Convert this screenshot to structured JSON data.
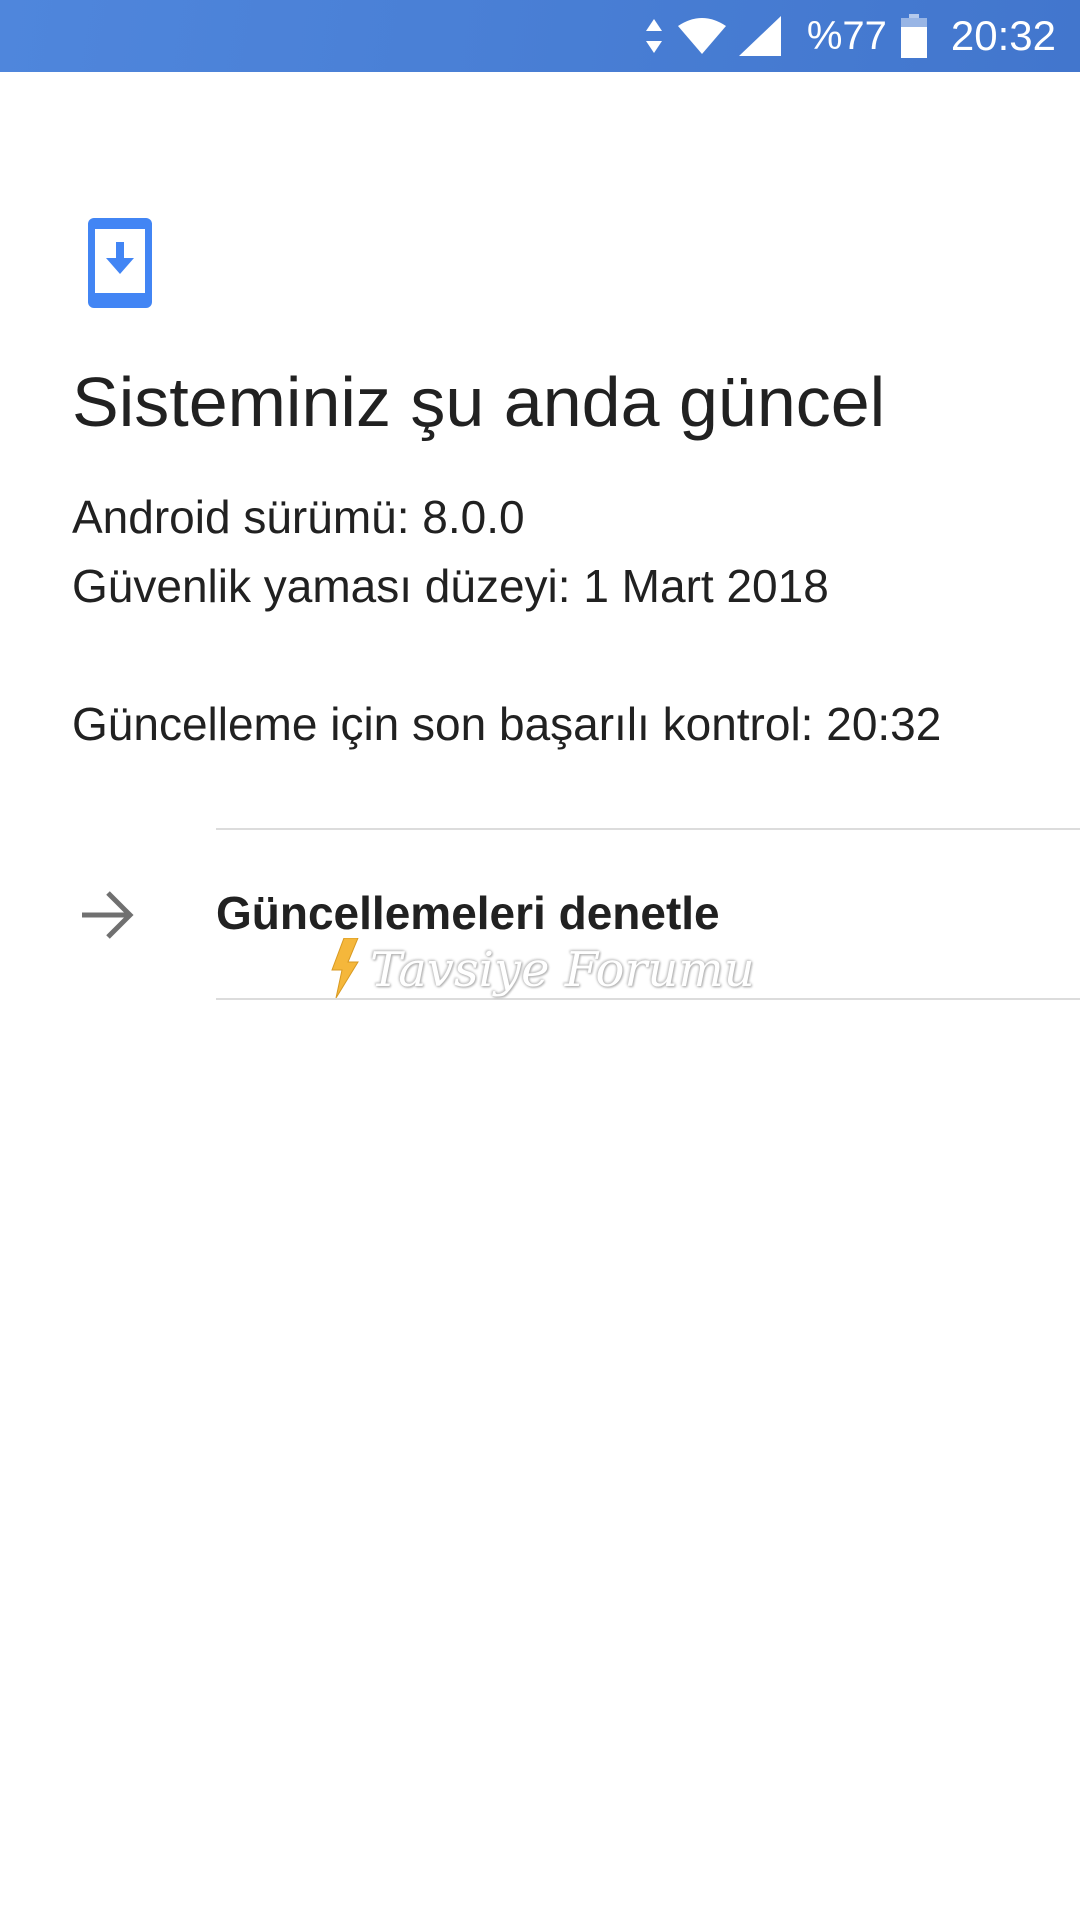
{
  "status_bar": {
    "battery_percent_text": "%77",
    "clock": "20:32",
    "icons": [
      "data-arrows-icon",
      "wifi-icon",
      "cell-signal-icon",
      "battery-icon"
    ],
    "background_color": "#4a80d6"
  },
  "main": {
    "icon": "system-update-phone-icon",
    "icon_color": "#4285f4",
    "title": "Sisteminiz şu anda güncel",
    "android_version": "Android sürümü: 8.0.0",
    "security_patch": "Güvenlik yaması düzeyi: 1 Mart 2018",
    "last_check": "Güncelleme için son başarılı kontrol: 20:32",
    "check_updates": {
      "icon": "arrow-right-icon",
      "label": "Güncellemeleri denetle"
    }
  },
  "watermark": {
    "text": "Tavsiye Forumu",
    "icon": "lightning-bolt-icon",
    "icon_color": "#f5b73b"
  }
}
